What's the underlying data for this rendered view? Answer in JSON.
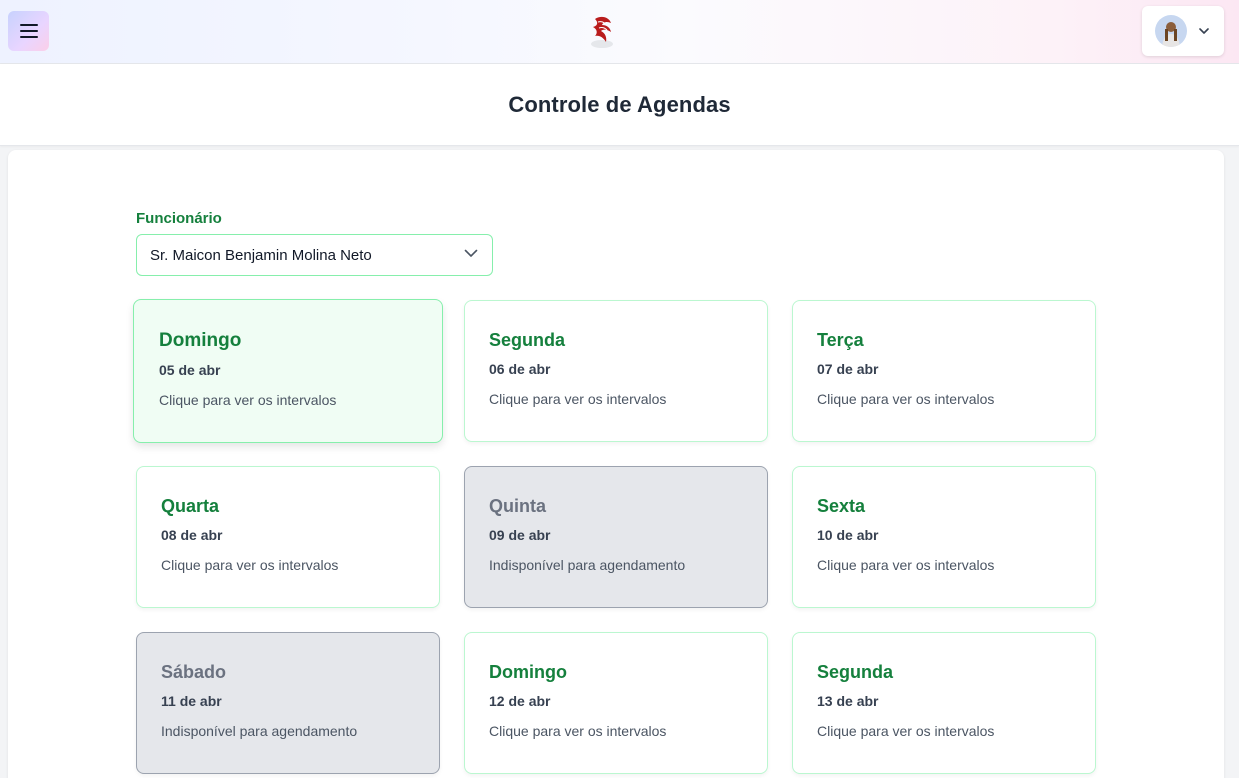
{
  "header": {
    "menu_icon": "hamburger-icon",
    "logo_icon": "phoenix-logo",
    "avatar_icon": "user-avatar",
    "dropdown_icon": "chevron-down-icon"
  },
  "page": {
    "title": "Controle de Agendas"
  },
  "filter": {
    "label": "Funcionário",
    "selected": "Sr. Maicon Benjamin Molina Neto"
  },
  "days": [
    {
      "name": "Domingo",
      "date": "05 de abr",
      "hint": "Clique para ver os intervalos",
      "state": "selected"
    },
    {
      "name": "Segunda",
      "date": "06 de abr",
      "hint": "Clique para ver os intervalos",
      "state": "available"
    },
    {
      "name": "Terça",
      "date": "07 de abr",
      "hint": "Clique para ver os intervalos",
      "state": "available"
    },
    {
      "name": "Quarta",
      "date": "08 de abr",
      "hint": "Clique para ver os intervalos",
      "state": "available"
    },
    {
      "name": "Quinta",
      "date": "09 de abr",
      "hint": "Indisponível para agendamento",
      "state": "disabled"
    },
    {
      "name": "Sexta",
      "date": "10 de abr",
      "hint": "Clique para ver os intervalos",
      "state": "available"
    },
    {
      "name": "Sábado",
      "date": "11 de abr",
      "hint": "Indisponível para agendamento",
      "state": "disabled"
    },
    {
      "name": "Domingo",
      "date": "12 de abr",
      "hint": "Clique para ver os intervalos",
      "state": "available"
    },
    {
      "name": "Segunda",
      "date": "13 de abr",
      "hint": "Clique para ver os intervalos",
      "state": "available"
    }
  ],
  "colors": {
    "accent": "#15803d",
    "card_border": "#bbf7d0",
    "selected_bg": "#f0fdf4",
    "disabled_bg": "#e5e7eb"
  }
}
